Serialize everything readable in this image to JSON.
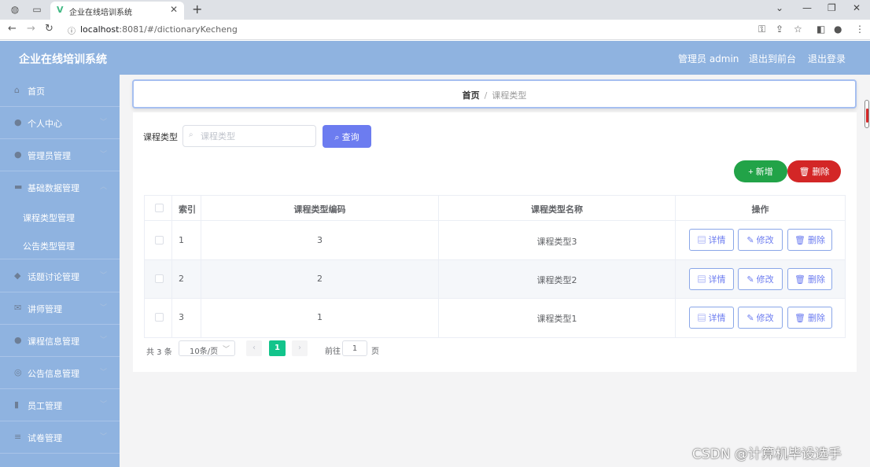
{
  "browser": {
    "tab_title": "企业在线培训系统",
    "url_host": "localhost",
    "url_path": ":8081/#/dictionaryKecheng"
  },
  "header": {
    "title": "企业在线培训系统",
    "admin_label": "管理员 admin",
    "front_link": "退出到前台",
    "logout_link": "退出登录"
  },
  "sidebar": {
    "items": [
      {
        "label": "首页",
        "icon": "home-icon"
      },
      {
        "label": "个人中心",
        "icon": "user-icon"
      },
      {
        "label": "管理员管理",
        "icon": "user-icon"
      },
      {
        "label": "基础数据管理",
        "icon": "monitor-icon"
      },
      {
        "label": "话题讨论管理",
        "icon": "location-icon"
      },
      {
        "label": "讲师管理",
        "icon": "message-icon"
      },
      {
        "label": "课程信息管理",
        "icon": "user-icon"
      },
      {
        "label": "公告信息管理",
        "icon": "compass-icon"
      },
      {
        "label": "员工管理",
        "icon": "chart-icon"
      },
      {
        "label": "试卷管理",
        "icon": "menu-icon"
      }
    ],
    "sub_items": [
      {
        "label": "课程类型管理"
      },
      {
        "label": "公告类型管理"
      }
    ]
  },
  "breadcrumb": {
    "home": "首页",
    "separator": "/",
    "current": "课程类型"
  },
  "search": {
    "label": "课程类型",
    "placeholder": "课程类型",
    "query_button": "查询"
  },
  "actions": {
    "add_button": "新增",
    "delete_button": "删除"
  },
  "table": {
    "headers": {
      "index": "索引",
      "code": "课程类型编码",
      "name": "课程类型名称",
      "ops": "操作"
    },
    "rows": [
      {
        "index": "1",
        "code": "3",
        "name": "课程类型3"
      },
      {
        "index": "2",
        "code": "2",
        "name": "课程类型2"
      },
      {
        "index": "3",
        "code": "1",
        "name": "课程类型1"
      }
    ],
    "op_labels": {
      "detail": "详情",
      "edit": "修改",
      "delete": "删除"
    }
  },
  "pagination": {
    "total": "共 3 条",
    "page_size": "10条/页",
    "current_page": "1",
    "goto_label": "前往",
    "goto_value": "1",
    "page_suffix": "页"
  },
  "watermark": "CSDN @计算机毕设选手",
  "colors": {
    "header_bg": "#8fb3e0",
    "query_button": "#6c7cf0",
    "add_button": "#22a348",
    "delete_button": "#d32626",
    "active_page": "#12c48b"
  }
}
